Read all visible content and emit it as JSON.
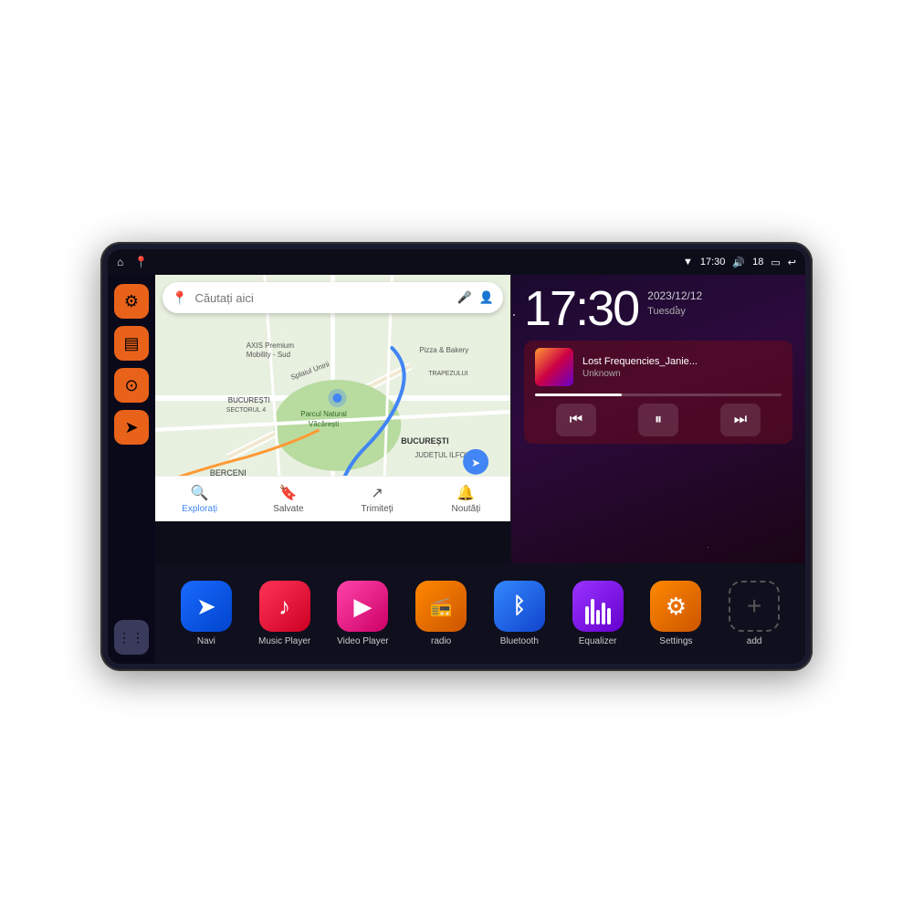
{
  "status_bar": {
    "left_icons": [
      "home",
      "location"
    ],
    "wifi_icon": "▼",
    "time": "17:30",
    "volume_icon": "🔊",
    "battery_level": "18",
    "battery_icon": "▭",
    "back_icon": "↩"
  },
  "sidebar": {
    "buttons": [
      {
        "id": "settings",
        "icon": "⚙",
        "color": "orange"
      },
      {
        "id": "folder",
        "icon": "▤",
        "color": "orange"
      },
      {
        "id": "map",
        "icon": "⊙",
        "color": "orange"
      },
      {
        "id": "navigation",
        "icon": "➤",
        "color": "orange"
      }
    ],
    "bottom": {
      "id": "apps",
      "icon": "⋮⋮⋮",
      "color": "gray"
    }
  },
  "map": {
    "search_placeholder": "Căutați aici",
    "nav_items": [
      {
        "label": "Explorați",
        "icon": "🔍",
        "active": true
      },
      {
        "label": "Salvate",
        "icon": "🔖",
        "active": false
      },
      {
        "label": "Trimiteți",
        "icon": "↗",
        "active": false
      },
      {
        "label": "Noutăți",
        "icon": "🔔",
        "active": false
      }
    ],
    "locations": [
      "AXIS Premium Mobility - Sud",
      "Parcul Natural Văcărești",
      "Pizza & Bakery",
      "TRAPEZULUI",
      "BUCUREȘTI SECTORUL 4",
      "JUDEȚUL ILFOV",
      "BERCENI"
    ]
  },
  "clock": {
    "time": "17:30",
    "date": "2023/12/12",
    "day": "Tuesday"
  },
  "music": {
    "track_name": "Lost Frequencies_Janie...",
    "artist": "Unknown",
    "progress": 35,
    "controls": [
      "prev",
      "pause",
      "next"
    ]
  },
  "apps": [
    {
      "id": "navi",
      "label": "Navi",
      "icon": "➤",
      "style": "blue"
    },
    {
      "id": "music_player",
      "label": "Music Player",
      "icon": "♪",
      "style": "red"
    },
    {
      "id": "video_player",
      "label": "Video Player",
      "icon": "▶",
      "style": "pink"
    },
    {
      "id": "radio",
      "label": "radio",
      "icon": "📻",
      "style": "orange"
    },
    {
      "id": "bluetooth",
      "label": "Bluetooth",
      "icon": "ᛒ",
      "style": "bluetooth"
    },
    {
      "id": "equalizer",
      "label": "Equalizer",
      "icon": "⋮⋮",
      "style": "eq"
    },
    {
      "id": "settings",
      "label": "Settings",
      "icon": "⚙",
      "style": "settings"
    },
    {
      "id": "add",
      "label": "add",
      "icon": "+",
      "style": "add"
    }
  ]
}
